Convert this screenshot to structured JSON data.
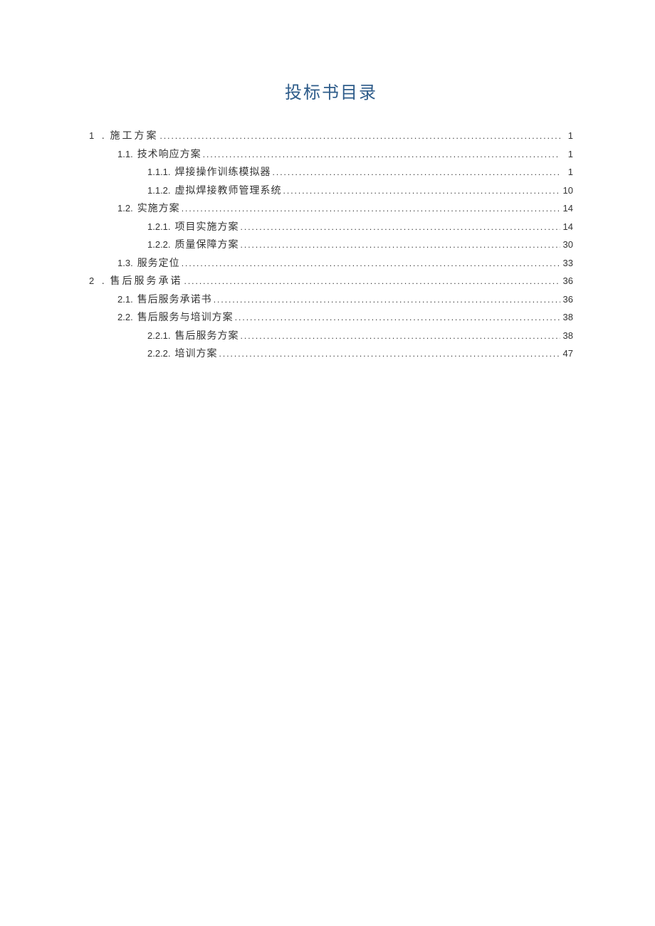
{
  "title": "投标书目录",
  "toc": [
    {
      "level": 1,
      "num": "1",
      "sep": ".",
      "label": "施工方案",
      "page": "1"
    },
    {
      "level": 2,
      "num": "1.1.",
      "label": "技术响应方案",
      "page": "1"
    },
    {
      "level": 3,
      "num": "1.1.1.",
      "label": "焊接操作训练模拟器",
      "page": "1"
    },
    {
      "level": 3,
      "num": "1.1.2.",
      "label": "虚拟焊接教师管理系统",
      "page": "10"
    },
    {
      "level": 2,
      "num": "1.2.",
      "label": "实施方案",
      "page": "14"
    },
    {
      "level": 3,
      "num": "1.2.1.",
      "label": "项目实施方案",
      "page": "14"
    },
    {
      "level": 3,
      "num": "1.2.2.",
      "label": "质量保障方案",
      "page": "30"
    },
    {
      "level": 2,
      "num": "1.3.",
      "label": "服务定位",
      "page": "33"
    },
    {
      "level": 1,
      "num": "2",
      "sep": ".",
      "label": "售后服务承诺",
      "page": "36"
    },
    {
      "level": 2,
      "num": "2.1.",
      "label": "售后服务承诺书",
      "page": "36"
    },
    {
      "level": 2,
      "num": "2.2.",
      "label": "售后服务与培训方案",
      "page": "38"
    },
    {
      "level": 3,
      "num": "2.2.1.",
      "label": "售后服务方案",
      "page": "38"
    },
    {
      "level": 3,
      "num": "2.2.2.",
      "label": "培训方案",
      "page": "47"
    }
  ]
}
